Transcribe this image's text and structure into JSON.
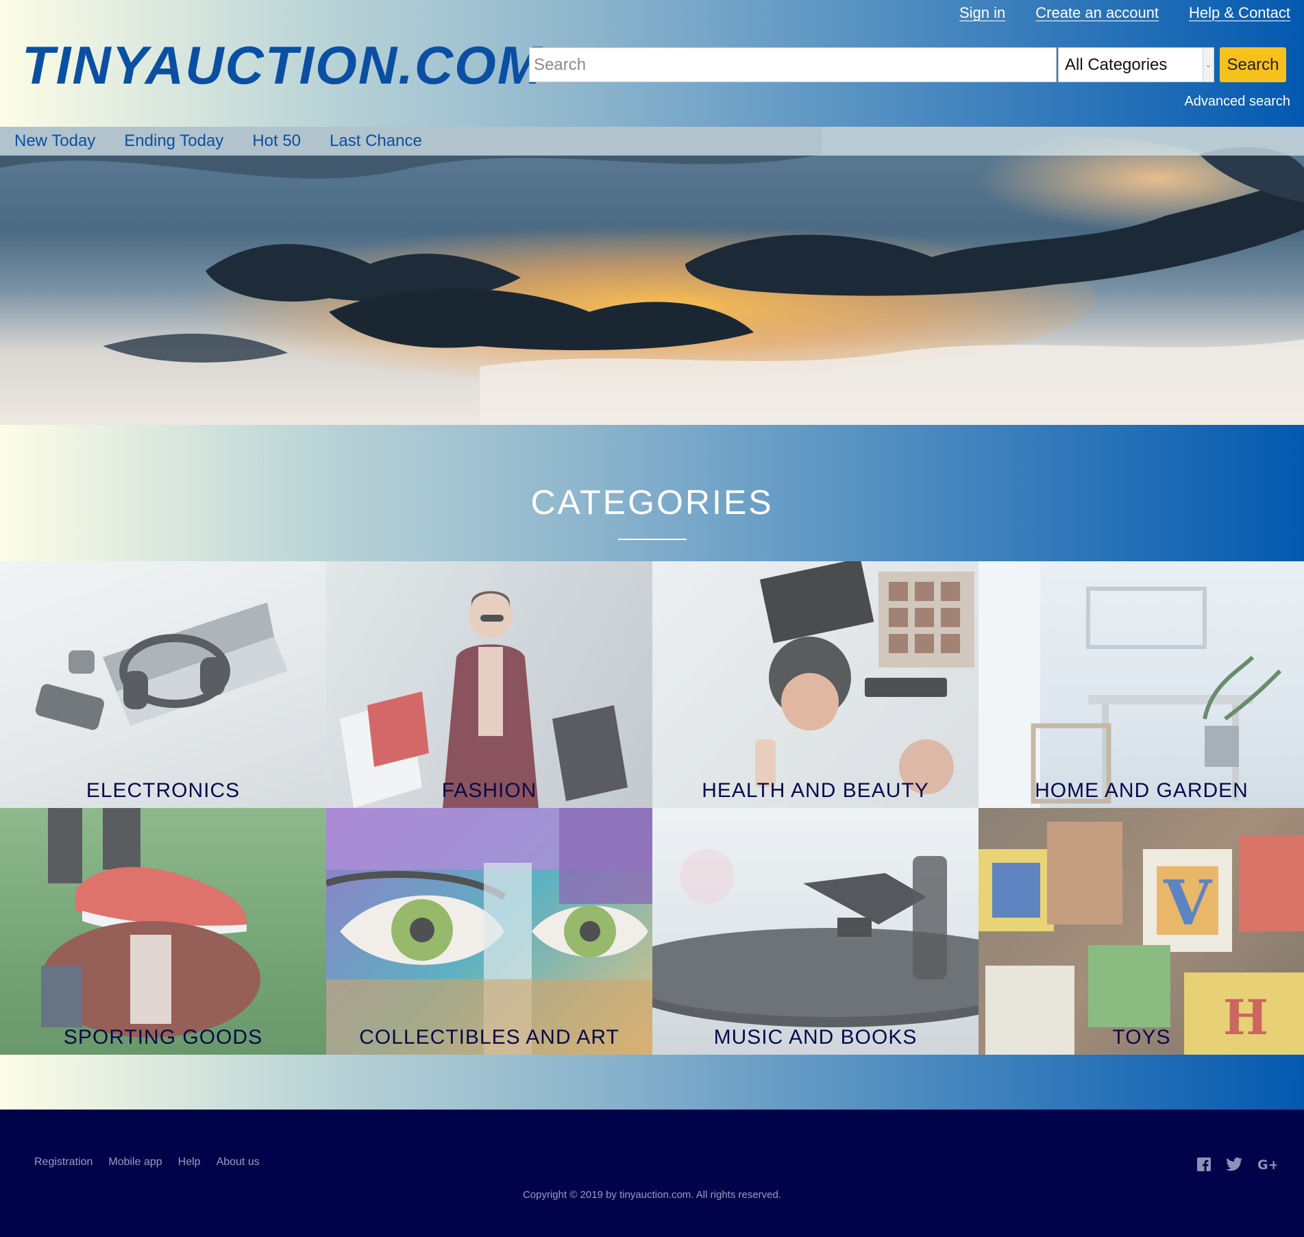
{
  "header": {
    "logo": "TINYAUCTION.COM",
    "top_links": [
      {
        "label": "Sign in"
      },
      {
        "label": "Create an account"
      },
      {
        "label": "Help & Contact"
      }
    ],
    "search": {
      "placeholder": "Search",
      "category_selected": "All Categories",
      "button_label": "Search",
      "advanced_label": "Advanced search"
    }
  },
  "nav": {
    "items": [
      {
        "label": "New Today"
      },
      {
        "label": "Ending Today"
      },
      {
        "label": "Hot 50"
      },
      {
        "label": "Last Chance"
      }
    ]
  },
  "categories": {
    "title": "CATEGORIES",
    "items": [
      {
        "label": "ELECTRONICS"
      },
      {
        "label": "FASHION"
      },
      {
        "label": "HEALTH AND BEAUTY"
      },
      {
        "label": "HOME AND GARDEN"
      },
      {
        "label": "SPORTING GOODS"
      },
      {
        "label": "COLLECTIBLES AND ART"
      },
      {
        "label": "MUSIC AND BOOKS"
      },
      {
        "label": "TOYS"
      }
    ]
  },
  "footer": {
    "links": [
      {
        "label": "Registration"
      },
      {
        "label": "Mobile app"
      },
      {
        "label": "Help"
      },
      {
        "label": "About us"
      }
    ],
    "copyright": "Copyright © 2019 by tinyauction.com. All rights reserved.",
    "social_icons": [
      "facebook-icon",
      "twitter-icon",
      "google-plus-icon"
    ]
  },
  "colors": {
    "brand_blue": "#0b4fa3",
    "search_button": "#f7c11d",
    "footer_bg": "#01034a",
    "category_label": "#080a4a"
  }
}
